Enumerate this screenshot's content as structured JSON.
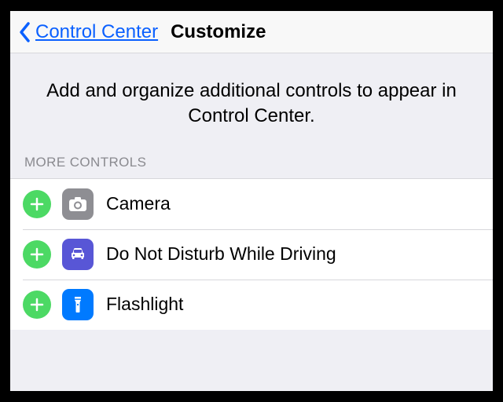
{
  "nav": {
    "back_label": "Control Center",
    "title": "Customize"
  },
  "description": "Add and organize additional controls to appear in Control Center.",
  "section_header": "MORE CONTROLS",
  "controls": [
    {
      "label": "Camera",
      "icon": "camera-icon"
    },
    {
      "label": "Do Not Disturb While Driving",
      "icon": "car-icon"
    },
    {
      "label": "Flashlight",
      "icon": "flashlight-icon"
    }
  ],
  "colors": {
    "accent_blue": "#007aff",
    "add_green": "#4cd964",
    "dnd_purple": "#5856d6",
    "icon_gray": "#8e8e93"
  }
}
